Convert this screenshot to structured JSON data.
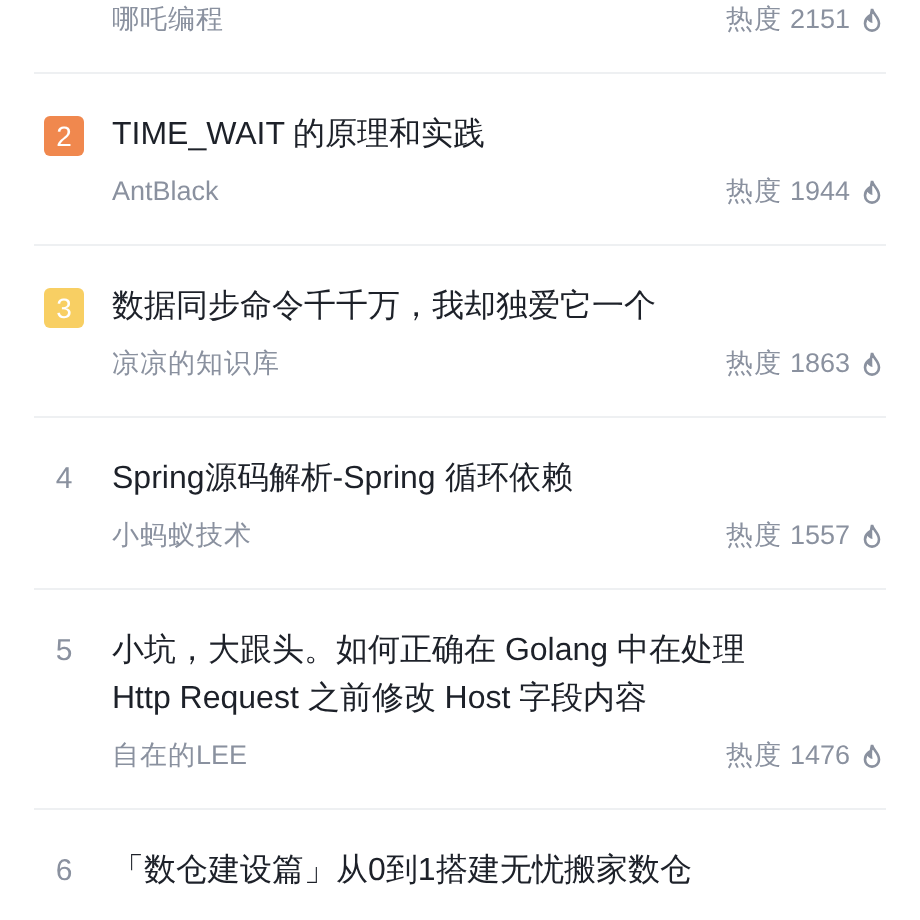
{
  "articles": [
    {
      "author": "哪吒编程",
      "heat": "热度 2151"
    },
    {
      "rank": "2",
      "kind": "badge",
      "color": "#f0884e",
      "title": "TIME_WAIT 的原理和实践",
      "author": "AntBlack",
      "heat": "热度 1944"
    },
    {
      "rank": "3",
      "kind": "badge",
      "color": "#f8cf63",
      "title": "数据同步命令千千万，我却独爱它一个",
      "author": "凉凉的知识库",
      "heat": "热度 1863"
    },
    {
      "rank": "4",
      "kind": "plain",
      "title": "Spring源码解析-Spring 循环依赖",
      "author": "小蚂蚁技术",
      "heat": "热度 1557"
    },
    {
      "rank": "5",
      "kind": "plain",
      "title": "小坑，大跟头。如何正确在 Golang 中在处理 Http Request 之前修改 Host 字段内容",
      "author": "自在的LEE",
      "heat": "热度 1476"
    },
    {
      "rank": "6",
      "kind": "plain",
      "title": "「数仓建设篇」从0到1搭建无忧搬家数仓"
    }
  ]
}
